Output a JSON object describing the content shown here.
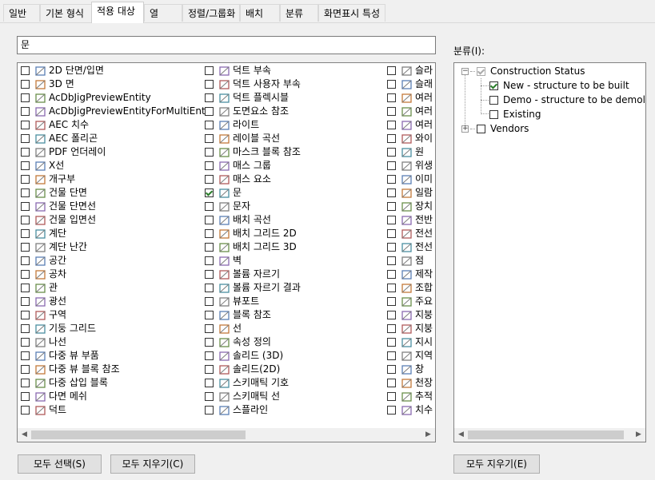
{
  "tabs": [
    "일반",
    "기본 형식",
    "적용 대상",
    "열",
    "정렬/그룹화",
    "배치",
    "분류",
    "화면표시 특성"
  ],
  "active_tab": "적용 대상",
  "search": {
    "value": "문"
  },
  "columns": [
    [
      {
        "label": "2D 단면/입면",
        "icon": "section-elevation-icon",
        "checked": false
      },
      {
        "label": "3D 면",
        "icon": "3d-face-icon",
        "checked": false
      },
      {
        "label": "AcDbJigPreviewEntity",
        "icon": "brush-icon",
        "checked": false
      },
      {
        "label": "AcDbJigPreviewEntityForMultiEnts",
        "icon": "brush-icon",
        "checked": false
      },
      {
        "label": "AEC 치수",
        "icon": "dimension-icon",
        "checked": false
      },
      {
        "label": "AEC 폴리곤",
        "icon": "polygon-icon",
        "checked": false
      },
      {
        "label": "PDF 언더레이",
        "icon": "pdf-icon",
        "checked": false
      },
      {
        "label": "X선",
        "icon": "xline-icon",
        "checked": false
      },
      {
        "label": "개구부",
        "icon": "opening-icon",
        "checked": false
      },
      {
        "label": "건물 단면",
        "icon": "building-section-icon",
        "checked": false
      },
      {
        "label": "건물 단면선",
        "icon": "section-line-icon",
        "checked": false
      },
      {
        "label": "건물 입면선",
        "icon": "elevation-line-icon",
        "checked": false
      },
      {
        "label": "계단",
        "icon": "stair-icon",
        "checked": false
      },
      {
        "label": "계단 난간",
        "icon": "railing-icon",
        "checked": false
      },
      {
        "label": "공간",
        "icon": "space-icon",
        "checked": false
      },
      {
        "label": "공차",
        "icon": "tolerance-icon",
        "checked": false
      },
      {
        "label": "관",
        "icon": "pipe-icon",
        "checked": false
      },
      {
        "label": "광선",
        "icon": "ray-icon",
        "checked": false
      },
      {
        "label": "구역",
        "icon": "zone-icon",
        "checked": false
      },
      {
        "label": "기둥 그리드",
        "icon": "column-grid-icon",
        "checked": false
      },
      {
        "label": "나선",
        "icon": "helix-icon",
        "checked": false
      },
      {
        "label": "다중 뷰 부품",
        "icon": "mvpart-icon",
        "checked": false
      },
      {
        "label": "다중 뷰 블록 참조",
        "icon": "mvblock-icon",
        "checked": false
      },
      {
        "label": "다중 삽입 블록",
        "icon": "minsert-icon",
        "checked": false
      },
      {
        "label": "다면 메쉬",
        "icon": "polyface-mesh-icon",
        "checked": false
      },
      {
        "label": "덕트",
        "icon": "duct-icon",
        "checked": false
      }
    ],
    [
      {
        "label": "덕트 부속",
        "icon": "duct-fitting-icon",
        "checked": false
      },
      {
        "label": "덕트 사용자 부속",
        "icon": "duct-custom-fitting-icon",
        "checked": false
      },
      {
        "label": "덕트 플렉시블",
        "icon": "duct-flex-icon",
        "checked": false
      },
      {
        "label": "도면요소 참조",
        "icon": "element-ref-icon",
        "checked": false
      },
      {
        "label": "라이트",
        "icon": "light-icon",
        "checked": false
      },
      {
        "label": "레이블 곡선",
        "icon": "label-curve-icon",
        "checked": false
      },
      {
        "label": "마스크 블록 참조",
        "icon": "mask-block-icon",
        "checked": false
      },
      {
        "label": "매스 그룹",
        "icon": "mass-group-icon",
        "checked": false
      },
      {
        "label": "매스 요소",
        "icon": "mass-element-icon",
        "checked": false
      },
      {
        "label": "문",
        "icon": "door-icon",
        "checked": true
      },
      {
        "label": "문자",
        "icon": "text-icon",
        "checked": false
      },
      {
        "label": "배치 곡선",
        "icon": "layout-curve-icon",
        "checked": false
      },
      {
        "label": "배치 그리드 2D",
        "icon": "layout-grid-2d-icon",
        "checked": false
      },
      {
        "label": "배치 그리드 3D",
        "icon": "layout-grid-3d-icon",
        "checked": false
      },
      {
        "label": "벽",
        "icon": "wall-icon",
        "checked": false
      },
      {
        "label": "볼륨 자르기",
        "icon": "volume-clip-icon",
        "checked": false
      },
      {
        "label": "볼륨 자르기 결과",
        "icon": "volume-clip-result-icon",
        "checked": false
      },
      {
        "label": "뷰포트",
        "icon": "viewport-icon",
        "checked": false
      },
      {
        "label": "블록 참조",
        "icon": "block-ref-icon",
        "checked": false
      },
      {
        "label": "선",
        "icon": "line-icon",
        "checked": false
      },
      {
        "label": "속성 정의",
        "icon": "attdef-icon",
        "checked": false
      },
      {
        "label": "솔리드 (3D)",
        "icon": "solid-3d-icon",
        "checked": false
      },
      {
        "label": "솔리드(2D)",
        "icon": "solid-2d-icon",
        "checked": false
      },
      {
        "label": "스키매틱 기호",
        "icon": "schematic-symbol-icon",
        "checked": false
      },
      {
        "label": "스키매틱 선",
        "icon": "schematic-line-icon",
        "checked": false
      },
      {
        "label": "스플라인",
        "icon": "spline-icon",
        "checked": false
      }
    ],
    [
      {
        "label": "슬라",
        "icon": "slab-icon",
        "checked": false
      },
      {
        "label": "슬래",
        "icon": "slab-edge-icon",
        "checked": false
      },
      {
        "label": "여러",
        "icon": "mtext-icon",
        "checked": false
      },
      {
        "label": "여러",
        "icon": "mleader-icon",
        "checked": false
      },
      {
        "label": "여러",
        "icon": "mline-icon",
        "checked": false
      },
      {
        "label": "와이",
        "icon": "wipeout-icon",
        "checked": false
      },
      {
        "label": "원",
        "icon": "circle-icon",
        "checked": false
      },
      {
        "label": "위생",
        "icon": "plumbing-icon",
        "checked": false
      },
      {
        "label": "이미",
        "icon": "image-icon",
        "checked": false
      },
      {
        "label": "일람",
        "icon": "schedule-icon",
        "checked": false
      },
      {
        "label": "장치",
        "icon": "device-icon",
        "checked": false
      },
      {
        "label": "전반",
        "icon": "panel-icon",
        "checked": false
      },
      {
        "label": "전선",
        "icon": "wire-icon",
        "checked": false
      },
      {
        "label": "전선",
        "icon": "wire-fitting-icon",
        "checked": false
      },
      {
        "label": "점",
        "icon": "point-icon",
        "checked": false
      },
      {
        "label": "제작",
        "icon": "fabrication-icon",
        "checked": false
      },
      {
        "label": "조합",
        "icon": "assembly-icon",
        "checked": false
      },
      {
        "label": "주요",
        "icon": "key-icon",
        "checked": false
      },
      {
        "label": "지붕",
        "icon": "roof-icon",
        "checked": false
      },
      {
        "label": "지붕",
        "icon": "roof-slab-icon",
        "checked": false
      },
      {
        "label": "지시",
        "icon": "leader-icon",
        "checked": false
      },
      {
        "label": "지역",
        "icon": "region-icon",
        "checked": false
      },
      {
        "label": "창",
        "icon": "window-icon",
        "checked": false
      },
      {
        "label": "천장",
        "icon": "ceiling-grid-icon",
        "checked": false
      },
      {
        "label": "추적",
        "icon": "trace-icon",
        "checked": false
      },
      {
        "label": "치수",
        "icon": "dim-icon",
        "checked": false
      }
    ]
  ],
  "classification_label": "분류(I):",
  "tree": {
    "root": "Construction Status",
    "children": [
      {
        "label": "New - structure to be built",
        "checked": true
      },
      {
        "label": "Demo - structure to be demolished",
        "checked": false
      },
      {
        "label": "Existing",
        "checked": false
      }
    ],
    "second_root": "Vendors"
  },
  "buttons": {
    "select_all": "모두 선택(S)",
    "clear_all": "모두 지우기(C)",
    "clear_all_classification": "모두 지우기(E)"
  },
  "colors": {
    "accent": "#0078d7",
    "check": "#2a7d2a"
  }
}
